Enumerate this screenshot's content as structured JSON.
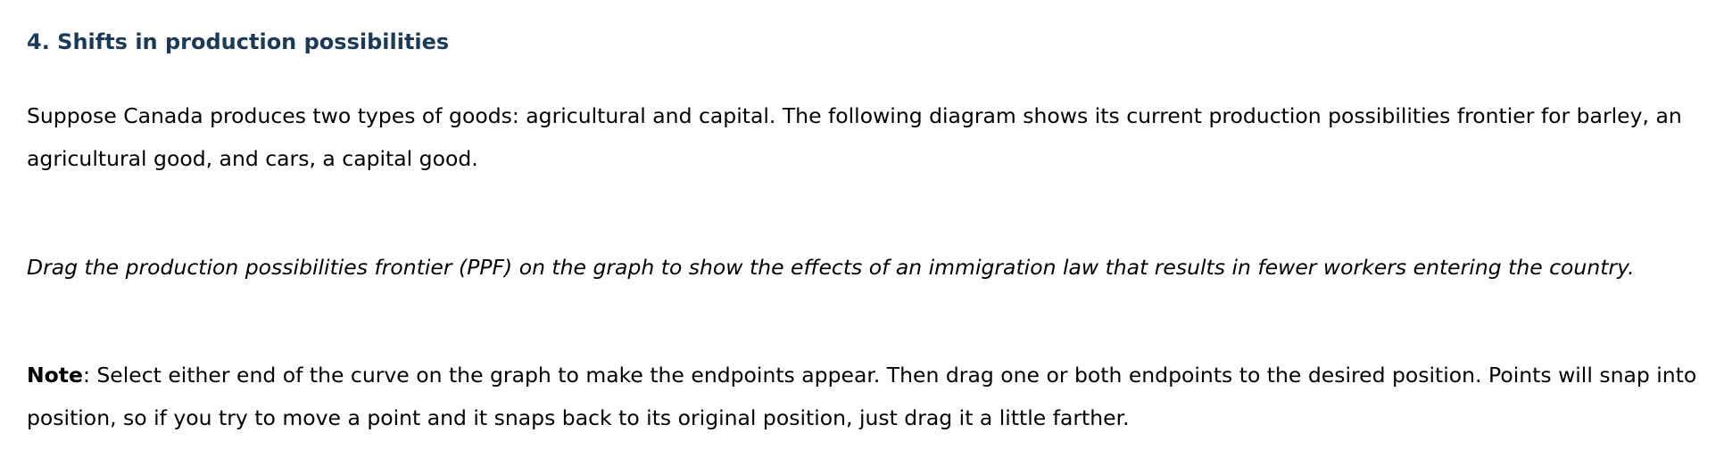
{
  "section": {
    "title": "4. Shifts in production possibilities",
    "title_color": "#1a3a5c"
  },
  "intro": {
    "text": "Suppose Canada produces two types of goods: agricultural and capital. The following diagram shows its current production possibilities frontier for barley, an agricultural good, and cars, a capital good."
  },
  "instruction": {
    "text": "Drag the production possibilities frontier (PPF) on the graph to show the effects of an immigration law that results in fewer workers entering the country."
  },
  "note": {
    "label": "Note",
    "text": ": Select either end of the curve on the graph to make the endpoints appear. Then drag one or both endpoints to the desired position. Points will snap into position, so if you try to move a point and it snaps back to its original position, just drag it a little farther."
  }
}
